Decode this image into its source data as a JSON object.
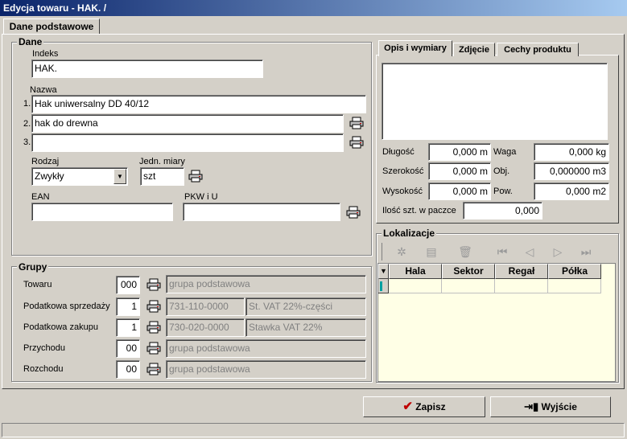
{
  "window": {
    "title": "Edycja towaru - HAK. /"
  },
  "tabs": {
    "main": "Dane podstawowe"
  },
  "dane": {
    "legend": "Dane",
    "indeks_label": "Indeks",
    "indeks_value": "HAK.",
    "nazwa_label": "Nazwa",
    "nazwa": [
      {
        "num": "1.",
        "value": "Hak uniwersalny DD 40/12"
      },
      {
        "num": "2.",
        "value": "hak do drewna"
      },
      {
        "num": "3.",
        "value": ""
      }
    ],
    "rodzaj_label": "Rodzaj",
    "rodzaj_value": "Zwykły",
    "jedn_label": "Jedn. miary",
    "jedn_value": "szt",
    "ean_label": "EAN",
    "ean_value": "",
    "pkwiu_label": "PKW i U",
    "pkwiu_value": ""
  },
  "grupy": {
    "legend": "Grupy",
    "rows": [
      {
        "label": "Towaru",
        "code": "000",
        "f1": "grupa podstawowa",
        "f2": ""
      },
      {
        "label": "Podatkowa sprzedaży",
        "code": "1",
        "f1": "731-110-0000",
        "f2": "St. VAT 22%-części"
      },
      {
        "label": "Podatkowa zakupu",
        "code": "1",
        "f1": "730-020-0000",
        "f2": "Stawka VAT 22%"
      },
      {
        "label": "Przychodu",
        "code": "00",
        "f1": "grupa podstawowa",
        "f2": ""
      },
      {
        "label": "Rozchodu",
        "code": "00",
        "f1": "grupa podstawowa",
        "f2": ""
      }
    ]
  },
  "right_tabs": [
    "Opis i wymiary",
    "Zdjęcie",
    "Cechy produktu"
  ],
  "wymiary": {
    "dlugosc_label": "Długość",
    "dlugosc": "0,000 m",
    "szerokosc_label": "Szerokość",
    "szerokosc": "0,000 m",
    "wysokosc_label": "Wysokość",
    "wysokosc": "0,000 m",
    "waga_label": "Waga",
    "waga": "0,000 kg",
    "obj_label": "Obj.",
    "obj": "0,000000 m3",
    "pow_label": "Pow.",
    "pow": "0,000 m2",
    "ilosc_label": "Ilość szt. w paczce",
    "ilosc": "0,000"
  },
  "lokalizacje": {
    "legend": "Lokalizacje",
    "columns": [
      "Hala",
      "Sektor",
      "Regał",
      "Półka"
    ]
  },
  "buttons": {
    "zapisz": "Zapisz",
    "wyjscie": "Wyjście"
  },
  "icons": {
    "printer": "printer-icon"
  }
}
